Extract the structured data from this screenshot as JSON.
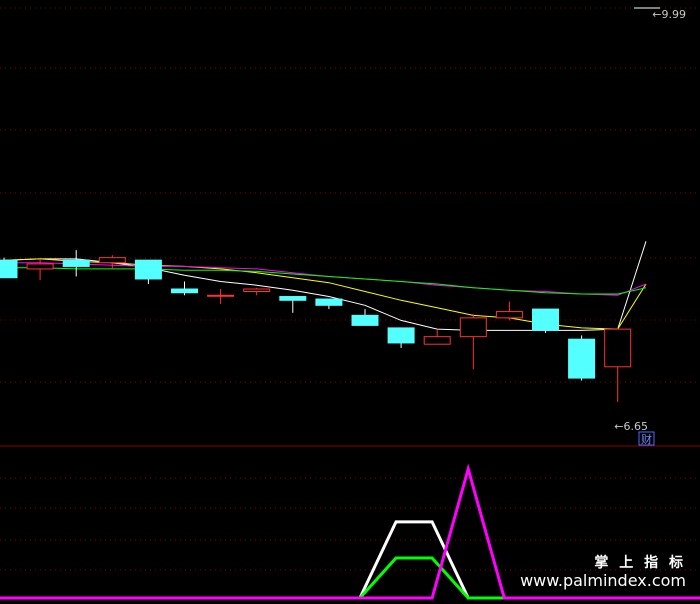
{
  "chart_data": [
    {
      "type": "candlestick",
      "title": "",
      "y_labels": {
        "max": "9.99",
        "min": "6.65"
      },
      "ylim": [
        6.65,
        9.99
      ],
      "badge": "财",
      "colors": {
        "up": "#ff3232",
        "down": "#54ffff",
        "grid": "#8b0000",
        "axis": "#8b0000"
      },
      "candles": [
        {
          "o": 7.98,
          "h": 8.0,
          "l": 7.84,
          "c": 7.84
        },
        {
          "o": 7.91,
          "h": 7.99,
          "l": 7.82,
          "c": 7.95
        },
        {
          "o": 7.98,
          "h": 8.06,
          "l": 7.85,
          "c": 7.93
        },
        {
          "o": 7.96,
          "h": 8.02,
          "l": 7.91,
          "c": 8.0
        },
        {
          "o": 7.98,
          "h": 7.98,
          "l": 7.79,
          "c": 7.83
        },
        {
          "o": 7.75,
          "h": 7.81,
          "l": 7.7,
          "c": 7.72
        },
        {
          "o": 7.7,
          "h": 7.75,
          "l": 7.63,
          "c": 7.7
        },
        {
          "o": 7.73,
          "h": 7.76,
          "l": 7.7,
          "c": 7.75
        },
        {
          "o": 7.69,
          "h": 7.69,
          "l": 7.56,
          "c": 7.66
        },
        {
          "o": 7.67,
          "h": 7.67,
          "l": 7.59,
          "c": 7.62
        },
        {
          "o": 7.54,
          "h": 7.59,
          "l": 7.46,
          "c": 7.46
        },
        {
          "o": 7.44,
          "h": 7.44,
          "l": 7.28,
          "c": 7.32
        },
        {
          "o": 7.31,
          "h": 7.43,
          "l": 7.31,
          "c": 7.37
        },
        {
          "o": 7.37,
          "h": 7.55,
          "l": 7.11,
          "c": 7.52
        },
        {
          "o": 7.52,
          "h": 7.65,
          "l": 7.5,
          "c": 7.57
        },
        {
          "o": 7.59,
          "h": 7.59,
          "l": 7.4,
          "c": 7.42
        },
        {
          "o": 7.35,
          "h": 7.38,
          "l": 7.02,
          "c": 7.04
        },
        {
          "o": 7.13,
          "h": 7.44,
          "l": 6.85,
          "c": 7.43
        }
      ],
      "ma_lines": [
        {
          "color": "#ffffff",
          "values": [
            7.98,
            7.99,
            7.99,
            7.96,
            7.92,
            7.86,
            7.81,
            7.78,
            7.74,
            7.69,
            7.62,
            7.5,
            7.43,
            7.42,
            7.42,
            7.42,
            7.42,
            7.43,
            8.13
          ]
        },
        {
          "color": "#ffff00",
          "values": [
            7.98,
            7.99,
            7.97,
            7.96,
            7.94,
            7.93,
            7.91,
            7.88,
            7.84,
            7.8,
            7.73,
            7.66,
            7.6,
            7.54,
            7.52,
            7.47,
            7.44,
            7.43,
            7.79
          ]
        },
        {
          "color": "#ff00ff",
          "values": [
            7.96,
            7.96,
            7.95,
            7.94,
            7.93,
            7.93,
            7.92,
            7.91,
            7.88,
            7.85,
            7.83,
            7.81,
            7.78,
            7.76,
            7.74,
            7.73,
            7.71,
            7.7,
            7.79
          ]
        },
        {
          "color": "#00ff00",
          "values": [
            7.92,
            7.92,
            7.91,
            7.91,
            7.91,
            7.9,
            7.9,
            7.89,
            7.87,
            7.85,
            7.83,
            7.81,
            7.79,
            7.76,
            7.74,
            7.72,
            7.71,
            7.71,
            7.76
          ]
        }
      ]
    },
    {
      "type": "line",
      "title": "",
      "ylim": [
        0,
        100
      ],
      "series": [
        {
          "color": "#ffffff",
          "values": [
            0,
            0,
            0,
            0,
            0,
            0,
            0,
            0,
            0,
            0,
            0,
            59,
            59,
            0,
            0,
            0,
            0,
            0
          ]
        },
        {
          "color": "#00ff00",
          "values": [
            0,
            0,
            0,
            0,
            0,
            0,
            0,
            0,
            0,
            0,
            0,
            31,
            31,
            0,
            0,
            0,
            0,
            0
          ]
        },
        {
          "color": "#ff00ff",
          "values": [
            0,
            0,
            0,
            0,
            0,
            0,
            0,
            0,
            0,
            0,
            0,
            0,
            0,
            100,
            0,
            0,
            0,
            0
          ]
        }
      ]
    }
  ],
  "watermark": {
    "line1": "掌 上 指 标",
    "line2": "www.palmindex.com"
  }
}
